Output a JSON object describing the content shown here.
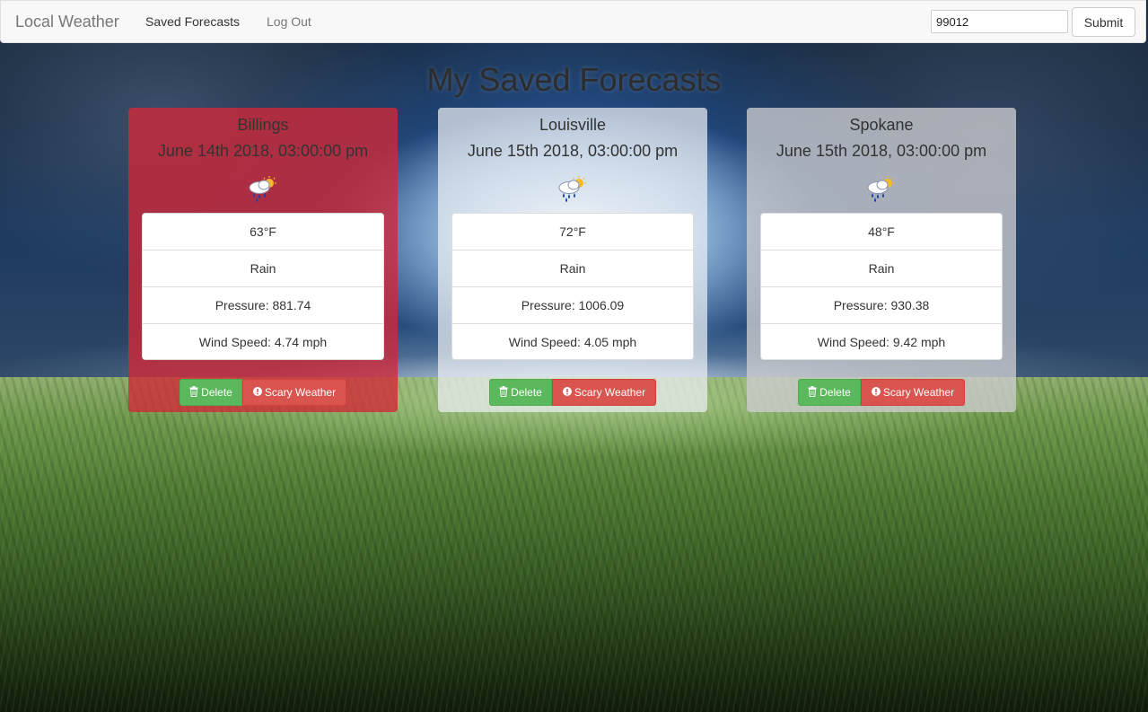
{
  "navbar": {
    "brand": "Local Weather",
    "links": [
      "Saved Forecasts",
      "Log Out"
    ],
    "zip_value": "99012",
    "submit_label": "Submit"
  },
  "page": {
    "title": "My Saved Forecasts"
  },
  "forecasts": [
    {
      "city": "Billings",
      "date": "June 14th 2018, 03:00:00 pm",
      "icon": "rain-sun-icon",
      "temp": "63°F",
      "condition": "Rain",
      "pressure": "Pressure: 881.74",
      "wind": "Wind Speed: 4.74 mph",
      "card_color": "#d22837",
      "delete_label": "Delete",
      "scary_label": "Scary Weather"
    },
    {
      "city": "Louisville",
      "date": "June 15th 2018, 03:00:00 pm",
      "icon": "rain-sun-icon",
      "temp": "72°F",
      "condition": "Rain",
      "pressure": "Pressure: 1006.09",
      "wind": "Wind Speed: 4.05 mph",
      "card_color": "#ebeef2",
      "delete_label": "Delete",
      "scary_label": "Scary Weather"
    },
    {
      "city": "Spokane",
      "date": "June 15th 2018, 03:00:00 pm",
      "icon": "rain-sun-icon",
      "temp": "48°F",
      "condition": "Rain",
      "pressure": "Pressure: 930.38",
      "wind": "Wind Speed: 9.42 mph",
      "card_color": "#cdcdd0",
      "delete_label": "Delete",
      "scary_label": "Scary Weather"
    }
  ],
  "colors": {
    "delete_button": "#5cb85c",
    "scary_button": "#d9534f"
  }
}
